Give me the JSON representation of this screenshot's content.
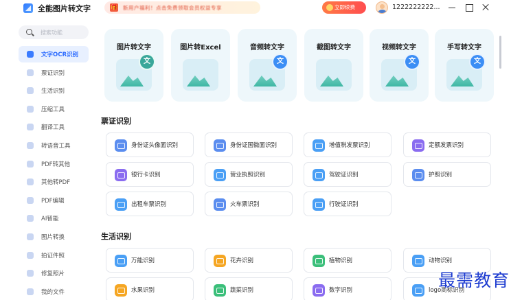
{
  "app": {
    "title": "全能图片转文字"
  },
  "header": {
    "promo_text": "新用户福利！点击免费领取会员权益专享",
    "vip_label": "立即续费",
    "username": "1222222222..."
  },
  "sidebar": {
    "search_placeholder": "搜索功能",
    "items": [
      {
        "label": "文字OCR识别",
        "active": true
      },
      {
        "label": "票证识别"
      },
      {
        "label": "生活识别"
      },
      {
        "label": "压缩工具"
      },
      {
        "label": "翻译工具"
      },
      {
        "label": "转语音工具"
      },
      {
        "label": "PDF转其他"
      },
      {
        "label": "其他转PDF"
      },
      {
        "label": "PDF编辑"
      },
      {
        "label": "AI智能"
      },
      {
        "label": "图片转换"
      },
      {
        "label": "拍证件照"
      },
      {
        "label": "修复照片"
      },
      {
        "label": "我的文件"
      }
    ]
  },
  "tools": [
    {
      "title": "图片转文字",
      "badge": "文"
    },
    {
      "title": "图片转Excel",
      "badge": ""
    },
    {
      "title": "音频转文字",
      "badge": "文"
    },
    {
      "title": "截图转文字",
      "badge": ""
    },
    {
      "title": "视频转文字",
      "badge": "文"
    },
    {
      "title": "手写转文字",
      "badge": "文"
    }
  ],
  "sections": [
    {
      "title": "票证识别",
      "items": [
        {
          "label": "身份证头像面识别",
          "color": "#5b8def"
        },
        {
          "label": "身份证国徽面识别",
          "color": "#5b8def"
        },
        {
          "label": "增值税发票识别",
          "color": "#4a9ff5"
        },
        {
          "label": "定额发票识别",
          "color": "#8a6cf0"
        },
        {
          "label": "银行卡识别",
          "color": "#8a6cf0"
        },
        {
          "label": "营业执照识别",
          "color": "#4a9ff5"
        },
        {
          "label": "驾驶证识别",
          "color": "#4a9ff5"
        },
        {
          "label": "护照识别",
          "color": "#5b8def"
        },
        {
          "label": "出租车票识别",
          "color": "#4a9ff5"
        },
        {
          "label": "火车票识别",
          "color": "#5b8def"
        },
        {
          "label": "行驶证识别",
          "color": "#4a9ff5"
        }
      ]
    },
    {
      "title": "生活识别",
      "items": [
        {
          "label": "万能识别",
          "color": "#4a9ff5"
        },
        {
          "label": "花卉识别",
          "color": "#f5a623"
        },
        {
          "label": "植物识别",
          "color": "#3bbf7a"
        },
        {
          "label": "动物识别",
          "color": "#4a9ff5"
        },
        {
          "label": "水果识别",
          "color": "#f5a623"
        },
        {
          "label": "蔬菜识别",
          "color": "#3bbf7a"
        },
        {
          "label": "数字识别",
          "color": "#8a6cf0"
        },
        {
          "label": "logo商标识别",
          "color": "#4a9ff5"
        }
      ]
    }
  ],
  "watermark": "最需教育"
}
